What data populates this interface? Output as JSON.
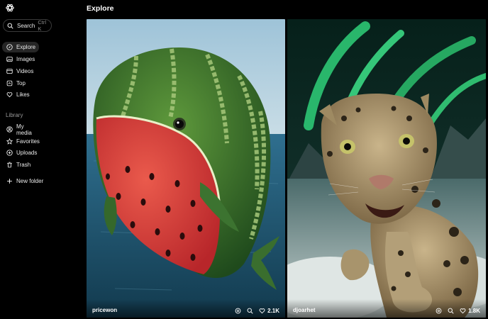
{
  "header": {
    "title": "Explore"
  },
  "search": {
    "label": "Search",
    "shortcut": "Ctrl K"
  },
  "nav": [
    {
      "label": "Explore",
      "icon": "compass-icon",
      "active": true
    },
    {
      "label": "Images",
      "icon": "image-icon"
    },
    {
      "label": "Videos",
      "icon": "video-icon"
    },
    {
      "label": "Top",
      "icon": "top-icon"
    },
    {
      "label": "Likes",
      "icon": "heart-icon"
    }
  ],
  "library": {
    "label": "Library",
    "items": [
      {
        "label": "My media",
        "icon": "my-media-icon"
      },
      {
        "label": "Favorites",
        "icon": "star-icon"
      },
      {
        "label": "Uploads",
        "icon": "upload-icon"
      },
      {
        "label": "Trash",
        "icon": "trash-icon"
      },
      {
        "label": "New folder",
        "icon": "new-folder-icon"
      }
    ]
  },
  "cards": [
    {
      "author": "pricewon",
      "likes": "2.1K",
      "image": "watermelon-whale-image"
    },
    {
      "author": "djoarhet",
      "likes": "1.8K",
      "image": "snow-leopard-aurora-image"
    }
  ],
  "colors": {
    "background": "#000000",
    "active_nav": "#262626",
    "muted_text": "#9a9a9a"
  }
}
